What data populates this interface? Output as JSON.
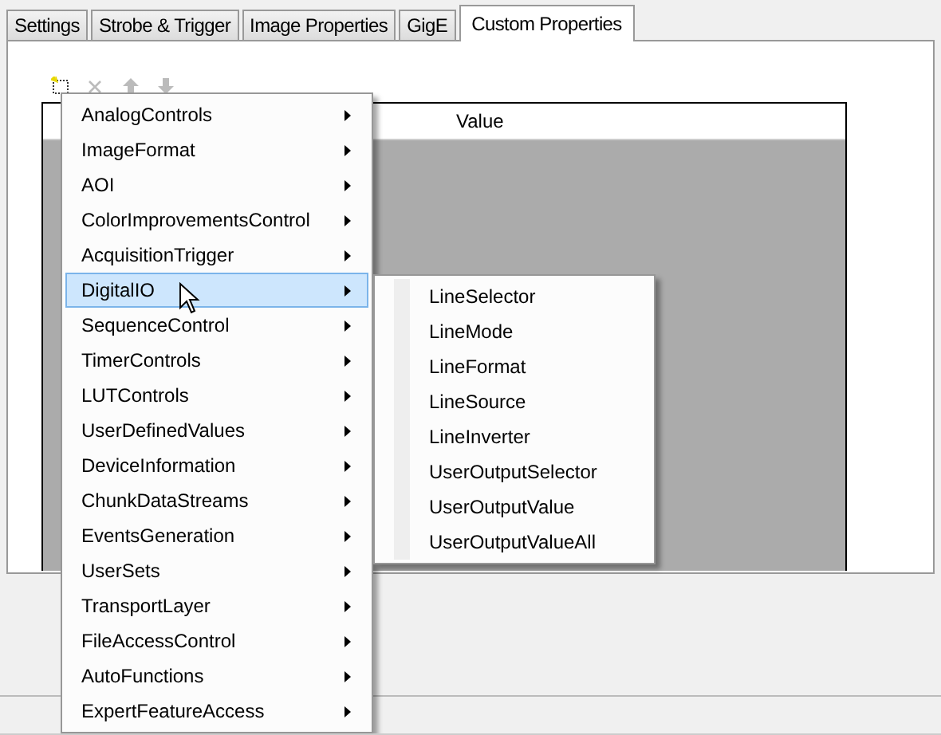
{
  "tabs": [
    {
      "label": "Settings",
      "selected": false
    },
    {
      "label": "Strobe & Trigger",
      "selected": false
    },
    {
      "label": "Image Properties",
      "selected": false
    },
    {
      "label": "GigE",
      "selected": false
    },
    {
      "label": "Custom Properties",
      "selected": true
    }
  ],
  "toolbar": [
    {
      "kind": "new",
      "disabled": false
    },
    {
      "kind": "delete",
      "disabled": true
    },
    {
      "kind": "up",
      "disabled": true
    },
    {
      "kind": "down",
      "disabled": true
    }
  ],
  "table": {
    "columns": [
      "Value"
    ]
  },
  "context_menu": {
    "items": [
      {
        "label": "AnalogControls",
        "selected": false
      },
      {
        "label": "ImageFormat",
        "selected": false
      },
      {
        "label": "AOI",
        "selected": false
      },
      {
        "label": "ColorImprovementsControl",
        "selected": false
      },
      {
        "label": "AcquisitionTrigger",
        "selected": false
      },
      {
        "label": "DigitalIO",
        "selected": true
      },
      {
        "label": "SequenceControl",
        "selected": false
      },
      {
        "label": "TimerControls",
        "selected": false
      },
      {
        "label": "LUTControls",
        "selected": false
      },
      {
        "label": "UserDefinedValues",
        "selected": false
      },
      {
        "label": "DeviceInformation",
        "selected": false
      },
      {
        "label": "ChunkDataStreams",
        "selected": false
      },
      {
        "label": "EventsGeneration",
        "selected": false
      },
      {
        "label": "UserSets",
        "selected": false
      },
      {
        "label": "TransportLayer",
        "selected": false
      },
      {
        "label": "FileAccessControl",
        "selected": false
      },
      {
        "label": "AutoFunctions",
        "selected": false
      },
      {
        "label": "ExpertFeatureAccess",
        "selected": false
      }
    ]
  },
  "submenu": {
    "items": [
      "LineSelector",
      "LineMode",
      "LineFormat",
      "LineSource",
      "LineInverter",
      "UserOutputSelector",
      "UserOutputValue",
      "UserOutputValueAll"
    ]
  }
}
